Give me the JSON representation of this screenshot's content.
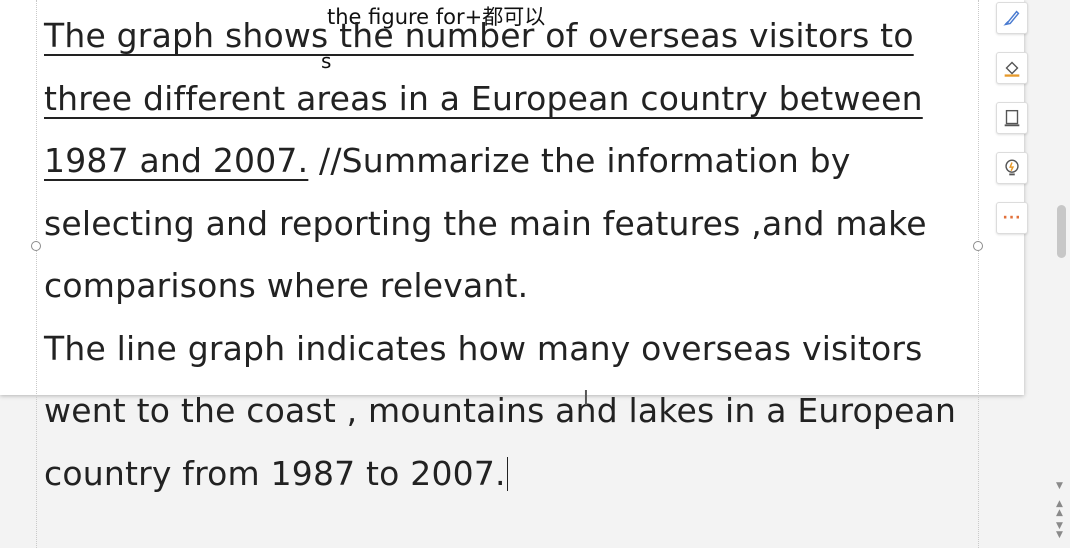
{
  "document": {
    "lines": [
      {
        "text": "The graph shows the number of overseas visitors to",
        "underlined": true
      },
      {
        "text": "three different areas in a European country between",
        "underlined": true
      },
      {
        "underlined_part": "1987 and 2007.",
        "rest": " //Summarize the information by"
      },
      {
        "text": "selecting and reporting the main features ,and make",
        "underlined": false
      },
      {
        "text": "comparisons where relevant.",
        "underlined": false
      },
      {
        "text": "The line graph indicates how many overseas visitors",
        "underlined": false
      },
      {
        "text": "went to the coast , mountains and lakes in a European",
        "underlined": false
      },
      {
        "text": "country from 1987 to 2007.",
        "underlined": false
      }
    ],
    "annotation": "the figure for+都可以",
    "annotation_mark": "s"
  },
  "toolbar": {
    "buttons": [
      {
        "name": "pen-icon",
        "color": "#4a7bd0"
      },
      {
        "name": "fill-icon",
        "color": "#e79a2b"
      },
      {
        "name": "border-icon",
        "color": "#555555"
      },
      {
        "name": "bulb-icon",
        "color": "#e79a2b"
      },
      {
        "name": "more-icon",
        "label": "···"
      }
    ]
  },
  "colors": {
    "text": "#222222",
    "accent": "#e2703a",
    "background": "#f3f3f3"
  }
}
